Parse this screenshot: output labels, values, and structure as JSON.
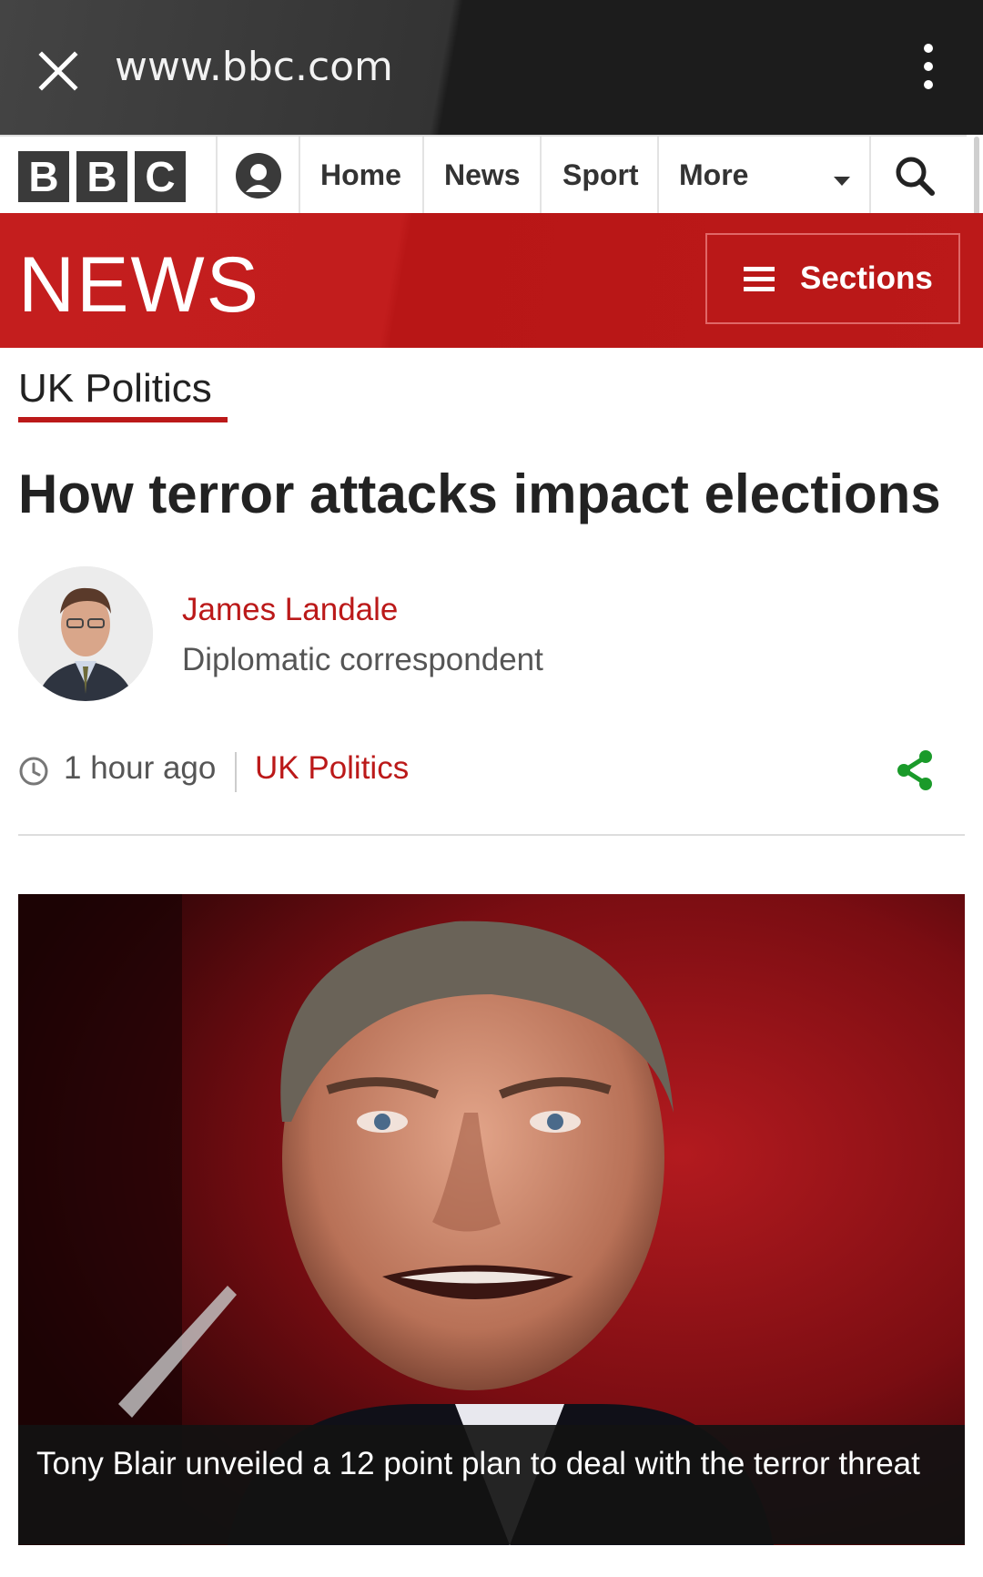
{
  "browser": {
    "url": "www.bbc.com"
  },
  "bbc_nav": {
    "logo_letters": [
      "B",
      "B",
      "C"
    ],
    "items": [
      {
        "label": "Home"
      },
      {
        "label": "News"
      },
      {
        "label": "Sport"
      },
      {
        "label": "More"
      }
    ]
  },
  "news_header": {
    "title": "NEWS",
    "sections_label": "Sections",
    "color": "#bb1919"
  },
  "article": {
    "section_tag": "UK Politics",
    "headline": "How terror attacks impact elections",
    "author": {
      "name": "James Landale",
      "role": "Diplomatic correspondent"
    },
    "meta": {
      "time": "1 hour ago",
      "section": "UK Politics"
    },
    "image_caption": "Tony Blair unveiled a 12 point plan to deal with the terror threat"
  },
  "icons": {
    "close": "close-icon",
    "menu": "kebab-menu-icon",
    "account": "account-icon",
    "search": "search-icon",
    "hamburger": "hamburger-icon",
    "clock": "clock-icon",
    "share": "share-icon"
  },
  "colors": {
    "accent_red": "#bb1919",
    "share_green": "#1a9a2a"
  }
}
